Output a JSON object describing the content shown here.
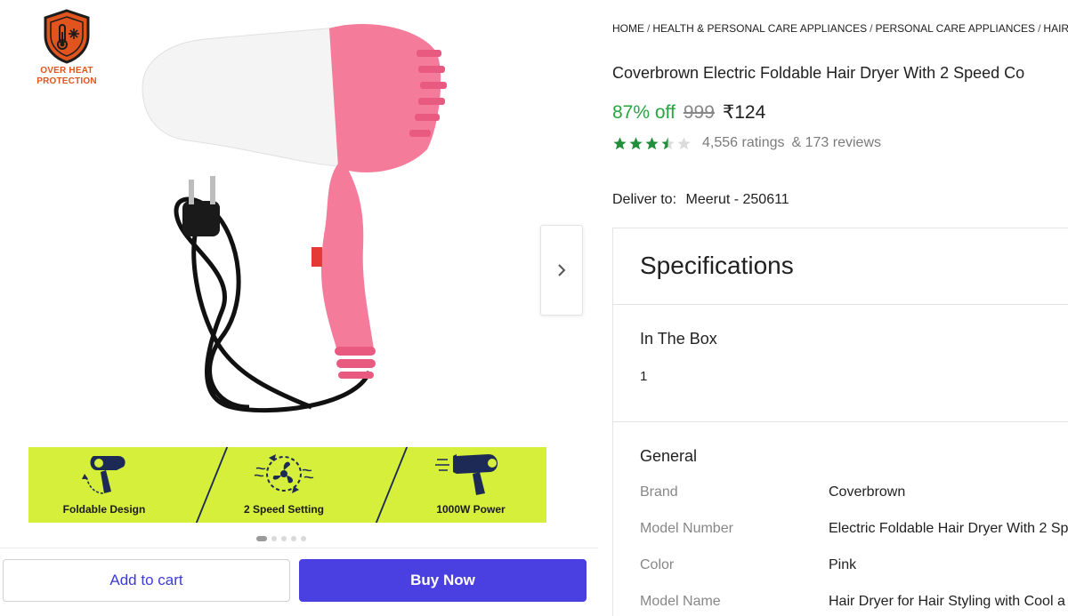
{
  "badge": {
    "text_line1": "OVER HEAT",
    "text_line2": "PROTECTION"
  },
  "gallery": {
    "image_alt": "Pink and white foldable hair dryer with black power cord",
    "features": [
      {
        "label": "Foldable Design",
        "icon": "foldable-dryer-icon"
      },
      {
        "label": "2 Speed Setting",
        "icon": "fan-speed-icon"
      },
      {
        "label": "1000W Power",
        "icon": "power-dryer-icon"
      }
    ],
    "dots_total": 5,
    "dots_active": 1,
    "colors": {
      "banner": "#d5ef3b",
      "divider": "#1c2a55"
    }
  },
  "actions": {
    "add_to_cart": "Add to cart",
    "buy_now": "Buy Now",
    "buy_color": "#4a3fe0"
  },
  "product": {
    "breadcrumb": [
      "HOME",
      "HEALTH & PERSONAL CARE APPLIANCES",
      "PERSONAL CARE APPLIANCES",
      "HAIR D"
    ],
    "title": "Coverbrown Electric Foldable Hair Dryer With 2 Speed Co",
    "discount": "87% off",
    "mrp": "999",
    "price": "₹124",
    "rating_value": 3.5,
    "ratings": "4,556 ratings",
    "reviews": "& 173 reviews",
    "deliver_label": "Deliver to:",
    "deliver_location": "Meerut - 250611",
    "colors": {
      "discount": "#26a541",
      "star": "#1f8f3a"
    }
  },
  "specifications": {
    "heading": "Specifications",
    "in_the_box": {
      "title": "In The Box",
      "value": "1"
    },
    "general": {
      "title": "General",
      "rows": [
        {
          "key": "Brand",
          "value": "Coverbrown"
        },
        {
          "key": "Model Number",
          "value": "Electric Foldable Hair Dryer With 2 Sp"
        },
        {
          "key": "Color",
          "value": "Pink"
        },
        {
          "key": "Model Name",
          "value": "Hair Dryer for Hair Styling with Cool a"
        }
      ]
    }
  }
}
